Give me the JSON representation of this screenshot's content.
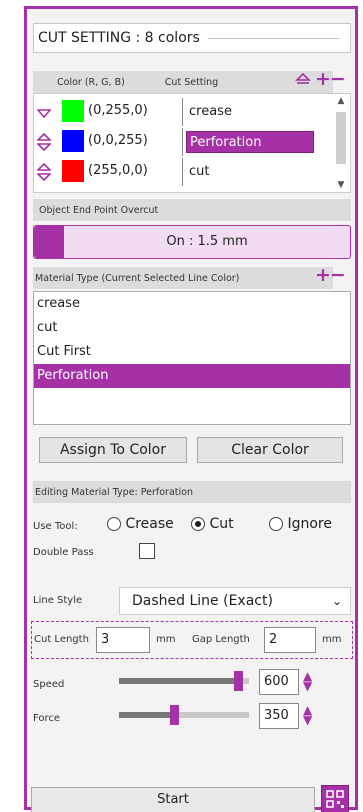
{
  "panel": {
    "title": "CUT SETTING : 8 colors",
    "accent": "#a630a6"
  },
  "color_table": {
    "header_color": "Color (R, G, B)",
    "header_cut": "Cut Setting",
    "rows": [
      {
        "swatch": "#00ff00",
        "rgb": "(0,255,0)",
        "setting": "crease",
        "selected": false
      },
      {
        "swatch": "#0000ff",
        "rgb": "(0,0,255)",
        "setting": "Perforation",
        "selected": true
      },
      {
        "swatch": "#ff0000",
        "rgb": "(255,0,0)",
        "setting": "cut",
        "selected": false
      }
    ]
  },
  "overcut": {
    "header": "Object End Point Overcut",
    "value": "On : 1.5 mm"
  },
  "material": {
    "header": "Material Type (Current Selected Line Color)",
    "items": [
      "crease",
      "cut",
      "Cut First",
      "Perforation"
    ],
    "selected": "Perforation"
  },
  "buttons": {
    "assign": "Assign To Color",
    "clear": "Clear Color",
    "start": "Start"
  },
  "editing": {
    "header": "Editing Material Type: Perforation",
    "use_tool_label": "Use Tool:",
    "tool_options": [
      "Crease",
      "Cut",
      "Ignore"
    ],
    "tool_selected": "Cut",
    "double_pass_label": "Double Pass",
    "double_pass": false,
    "line_style_label": "Line Style",
    "line_style": "Dashed Line (Exact)",
    "cut_length_label": "Cut Length",
    "cut_length": "3",
    "gap_length_label": "Gap Length",
    "gap_length": "2",
    "unit": "mm",
    "speed_label": "Speed",
    "speed": "600",
    "speed_fraction": 0.95,
    "force_label": "Force",
    "force": "350",
    "force_fraction": 0.42
  }
}
